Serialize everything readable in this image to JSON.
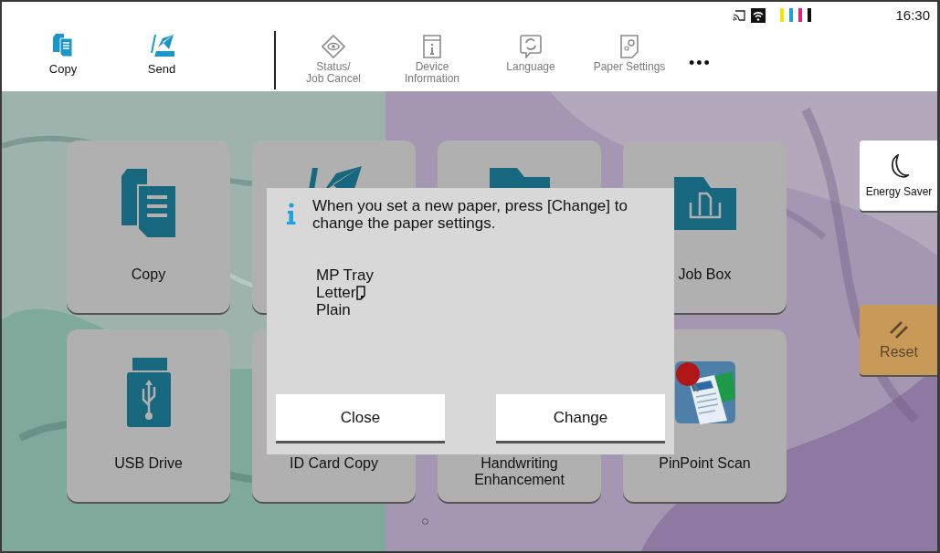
{
  "header": {
    "quick": [
      {
        "label": "Copy",
        "kind": "copy"
      },
      {
        "label": "Send",
        "kind": "send"
      }
    ],
    "menu": [
      {
        "label": "Status/\nJob Cancel",
        "kind": "status"
      },
      {
        "label": "Device\nInformation",
        "kind": "device"
      },
      {
        "label": "Language",
        "kind": "language"
      },
      {
        "label": "Paper Settings",
        "kind": "paper"
      }
    ],
    "more": "•••",
    "toners": [
      {
        "color": "#f2e600"
      },
      {
        "color": "#1aa3e0"
      },
      {
        "color": "#e0217a"
      },
      {
        "color": "#111111"
      }
    ],
    "time": "16:30"
  },
  "tiles": [
    {
      "kind": "copy",
      "label": "Copy"
    },
    {
      "kind": "send"
    },
    {
      "kind": "folder"
    },
    {
      "kind": "jobbox",
      "label": "Job Box"
    },
    {
      "kind": "usb",
      "label": "USB Drive"
    },
    {
      "kind": "blank",
      "label": "ID Card Copy"
    },
    {
      "kind": "blank",
      "label": "Handwriting Enhancement"
    },
    {
      "kind": "pinpoint",
      "label": "PinPoint Scan"
    }
  ],
  "side": [
    {
      "kind": "energy",
      "label": "Energy Saver"
    },
    {
      "kind": "reset",
      "label": "Reset"
    }
  ],
  "dialog": {
    "message": "When you set a new paper, press [Change] to change the paper settings.",
    "paper": [
      {
        "text": "MP Tray"
      },
      {
        "text": "Letter",
        "orientation_icon": true
      },
      {
        "text": "Plain"
      }
    ],
    "buttons": [
      "Close",
      "Change"
    ]
  }
}
